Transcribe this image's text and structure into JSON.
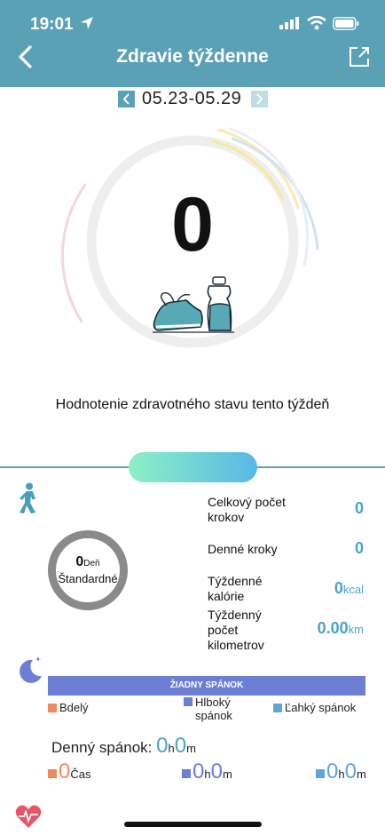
{
  "status_bar": {
    "time": "19:01"
  },
  "header": {
    "title": "Zdravie týždenne"
  },
  "week": {
    "range": "05.23-05.29"
  },
  "score": {
    "value": "0",
    "caption": "Hodnotenie zdravotného stavu tento týždeň"
  },
  "steps": {
    "donut_value": "0",
    "donut_unit": "Deň",
    "donut_label": "Štandardné",
    "stats": [
      {
        "label": "Celkový počet krokov",
        "value": "0",
        "unit": ""
      },
      {
        "label": "Denné kroky",
        "value": "0",
        "unit": ""
      },
      {
        "label": "Týždenné kalórie",
        "value": "0",
        "unit": "kcal"
      },
      {
        "label": "Týždenný počet kilometrov",
        "value": "0.00",
        "unit": "km"
      }
    ]
  },
  "sleep": {
    "bar_label": "ŽIADNY SPÁNOK",
    "legend": {
      "awake": "Bdelý",
      "deep": "Hlboký spánok",
      "light": "Ľahký spánok"
    },
    "daily_label": "Denný spánok:",
    "daily_h": "0",
    "daily_m": "0",
    "h_unit": "h",
    "m_unit": "m",
    "time_value": "0",
    "time_label": "Čas",
    "deep_h": "0",
    "deep_m": "0",
    "light_h": "0",
    "light_m": "0"
  },
  "colors": {
    "header": "#5aa1b5",
    "accent_value": "#4aa3c9",
    "awake": "#f08a5d",
    "deep": "#6c7fd4",
    "light": "#5fa6d6"
  },
  "icons": [
    "location-arrow-icon",
    "signal-icon",
    "wifi-icon",
    "battery-icon",
    "back-chevron-icon",
    "share-icon",
    "walking-icon",
    "moon-icon",
    "heart-icon"
  ]
}
